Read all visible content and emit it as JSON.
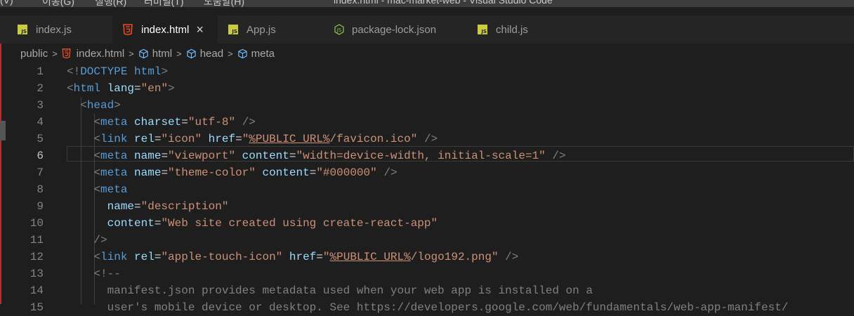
{
  "menu": {
    "items": [
      "(V)",
      "이동(G)",
      "실행(R)",
      "터미널(T)",
      "도움말(H)"
    ],
    "window_title": "index.html - mac-market-web - Visual Studio Code"
  },
  "tabs": [
    {
      "label": "index.js",
      "icon": "js-icon",
      "active": false
    },
    {
      "label": "index.html",
      "icon": "html5-icon",
      "active": true,
      "close": "×"
    },
    {
      "label": "App.js",
      "icon": "js-icon",
      "active": false
    },
    {
      "label": "package-lock.json",
      "icon": "nodejs-icon",
      "active": false
    },
    {
      "label": "child.js",
      "icon": "js-icon",
      "active": false
    }
  ],
  "breadcrumb": [
    "public",
    "index.html",
    "html",
    "head",
    "meta"
  ],
  "editor": {
    "active_line": 6,
    "line_numbers": [
      "1",
      "2",
      "3",
      "4",
      "5",
      "6",
      "7",
      "8",
      "9",
      "10",
      "11",
      "12",
      "13",
      "14",
      "15"
    ],
    "lines": [
      "<!DOCTYPE html>",
      "<html lang=\"en\">",
      "  <head>",
      "    <meta charset=\"utf-8\" />",
      "    <link rel=\"icon\" href=\"%PUBLIC_URL%/favicon.ico\" />",
      "    <meta name=\"viewport\" content=\"width=device-width, initial-scale=1\" />",
      "    <meta name=\"theme-color\" content=\"#000000\" />",
      "    <meta",
      "      name=\"description\"",
      "      content=\"Web site created using create-react-app\"",
      "    />",
      "    <link rel=\"apple-touch-icon\" href=\"%PUBLIC_URL%/logo192.png\" />",
      "    <!--",
      "      manifest.json provides metadata used when your web app is installed on a",
      "      user's mobile device or desktop. See https://developers.google.com/web/fundamentals/web-app-manifest/"
    ]
  },
  "colors": {
    "background": "#1e1e1e",
    "tab_bar": "#252526",
    "tag": "#569cd6",
    "attribute": "#9cdcfe",
    "string": "#ce9178",
    "comment": "#808080",
    "js_icon": "#cbcb41",
    "html_icon": "#e44d26"
  }
}
